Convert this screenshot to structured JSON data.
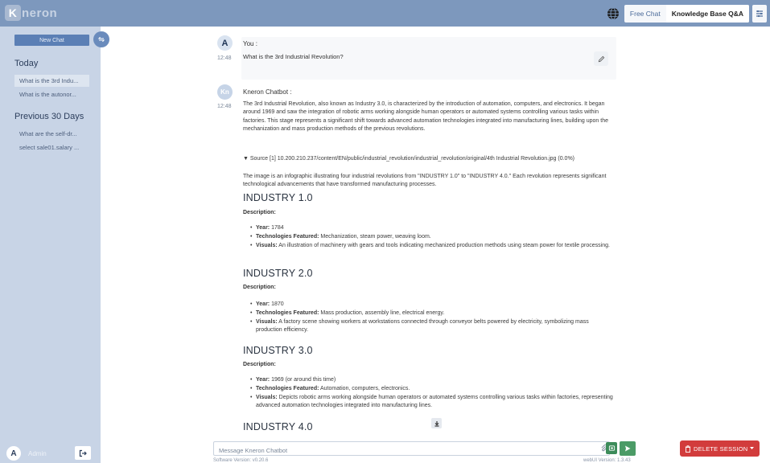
{
  "app": {
    "logo_text": "neron",
    "logo_letter": "K"
  },
  "topbar": {
    "modes": [
      "Free Chat",
      "Knowledge Base Q&A"
    ],
    "active_mode": "Knowledge Base Q&A"
  },
  "sidebar": {
    "new_chat_label": "New Chat",
    "today_title": "Today",
    "today_items": [
      "What is the 3rd Indu...",
      "What is the autonor..."
    ],
    "prev_title": "Previous 30 Days",
    "prev_items": [
      "What are the self-dr...",
      "select sale01.salary ..."
    ],
    "user_initial": "A",
    "user_name": "Admin"
  },
  "chat": {
    "user_initial": "A",
    "user_sender": "You :",
    "user_time": "12:48",
    "user_question": "What is the 3rd Industrial Revolution?",
    "bot_initial": "Kn",
    "bot_sender": "Kneron Chatbot :",
    "bot_time": "12:48",
    "bot_intro": "The 3rd Industrial Revolution, also known as Industry 3.0, is characterized by the introduction of automation, computers, and electronics. It began around 1969 and saw the integration of robotic arms working alongside human operators or automated systems controlling various tasks within factories. This stage represents a significant shift towards advanced automation technologies integrated into manufacturing lines, building upon the mechanization and mass production methods of the previous revolutions.",
    "source": "▼ Source [1] 10.200.210.237/content/EN/public/industrial_revolution/industrial_revolution/original/4th Industrial Revolution.jpg (0.0%)",
    "image_desc": "The image is an infographic illustrating four industrial revolutions from \"INDUSTRY 1.0\" to \"INDUSTRY 4.0.\" Each revolution represents significant technological advancements that have transformed manufacturing processes.",
    "description_label": "Description:",
    "year_label": "Year:",
    "tech_label": "Technologies Featured:",
    "visuals_label": "Visuals:",
    "industries": [
      {
        "title": "INDUSTRY 1.0",
        "year": "1784",
        "tech": "Mechanization, steam power, weaving loom.",
        "visuals": "An illustration of machinery with gears and tools indicating mechanized production methods using steam power for textile processing."
      },
      {
        "title": "INDUSTRY 2.0",
        "year": "1870",
        "tech": "Mass production, assembly line, electrical energy.",
        "visuals": "A factory scene showing workers at workstations connected through conveyor belts powered by electricity, symbolizing mass production efficiency."
      },
      {
        "title": "INDUSTRY 3.0",
        "year": "1969 (or around this time)",
        "tech": "Automation, computers, electronics.",
        "visuals": "Depicts robotic arms working alongside human operators or automated systems controlling various tasks within factories, representing advanced automation technologies integrated into manufacturing lines."
      },
      {
        "title": "INDUSTRY 4.0"
      }
    ]
  },
  "composer": {
    "placeholder": "Message Kneron Chatbot",
    "software_version": "Software Version: v0.20.6",
    "webui_version": "webUI Version: 1.3.43"
  },
  "actions": {
    "delete_label": "DELETE SESSION"
  },
  "colors": {
    "topbar": "#7d98bd",
    "sidebar": "#c8d4e6",
    "primary": "#5b7fb5",
    "danger": "#d23c3c",
    "send": "#4b9b66"
  },
  "icons": [
    "globe-icon",
    "menu-icon",
    "swap-icon",
    "logout-icon",
    "edit-icon",
    "paperclip-icon",
    "upload-icon",
    "send-icon",
    "trash-icon",
    "chevron-down-icon",
    "download-icon"
  ]
}
